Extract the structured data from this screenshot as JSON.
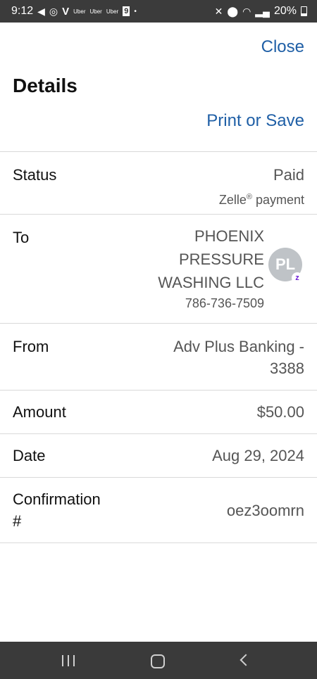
{
  "status_bar": {
    "time": "9:12",
    "notif_icons": [
      "telegram-icon",
      "wifi-calling-icon"
    ],
    "v_label": "V",
    "uber_labels": [
      "Uber",
      "Uber",
      "Uber"
    ],
    "nine_label": "9",
    "dot": "•",
    "battery": "20%"
  },
  "header": {
    "close_label": "Close",
    "title": "Details",
    "print_label": "Print or Save"
  },
  "details": {
    "status": {
      "label": "Status",
      "value": "Paid",
      "sub_prefix": "Zelle",
      "sub_mark": "®",
      "sub_suffix": " payment"
    },
    "to": {
      "label": "To",
      "name_lines": [
        "PHOENIX",
        "PRESSURE",
        "WASHING LLC"
      ],
      "phone": "786-736-7509",
      "avatar_initials": "PL",
      "badge": "z"
    },
    "from": {
      "label": "From",
      "value_lines": [
        "Adv Plus Banking -",
        "3388"
      ]
    },
    "amount": {
      "label": "Amount",
      "value": "$50.00"
    },
    "date": {
      "label": "Date",
      "value": "Aug 29, 2024"
    },
    "confirmation": {
      "label_lines": [
        "Confirmation",
        "#"
      ],
      "value": "oez3oomrn"
    }
  },
  "colors": {
    "link": "#1f5fa6",
    "zelle": "#6d1ed4"
  }
}
